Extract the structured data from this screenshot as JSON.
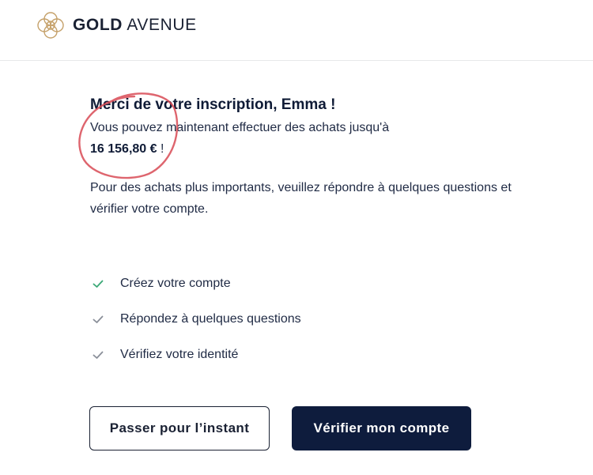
{
  "brand": {
    "strong": "GOLD",
    "light": "AVENUE",
    "gold_color": "#c5a16a"
  },
  "main": {
    "title": "Merci de votre inscription, Emma !",
    "subtitle_prefix": "Vous pouvez maintenant effectuer des achats jusqu'à",
    "amount": "16 156,80 €",
    "subtitle_suffix": " !",
    "paragraph": "Pour des achats plus importants, veuillez répondre à quelques questions et vérifier votre compte."
  },
  "steps": [
    {
      "label": "Créez votre compte",
      "status": "done",
      "icon": "check-icon",
      "color": "#3aa876"
    },
    {
      "label": "Répondez à quelques questions",
      "status": "pending",
      "icon": "check-icon",
      "color": "#8a8f99"
    },
    {
      "label": "Vérifiez votre identité",
      "status": "pending",
      "icon": "check-icon",
      "color": "#8a8f99"
    }
  ],
  "actions": {
    "skip_label": "Passer pour l’instant",
    "verify_label": "Vérifier mon compte"
  },
  "annotation": {
    "color": "#d84a55"
  }
}
